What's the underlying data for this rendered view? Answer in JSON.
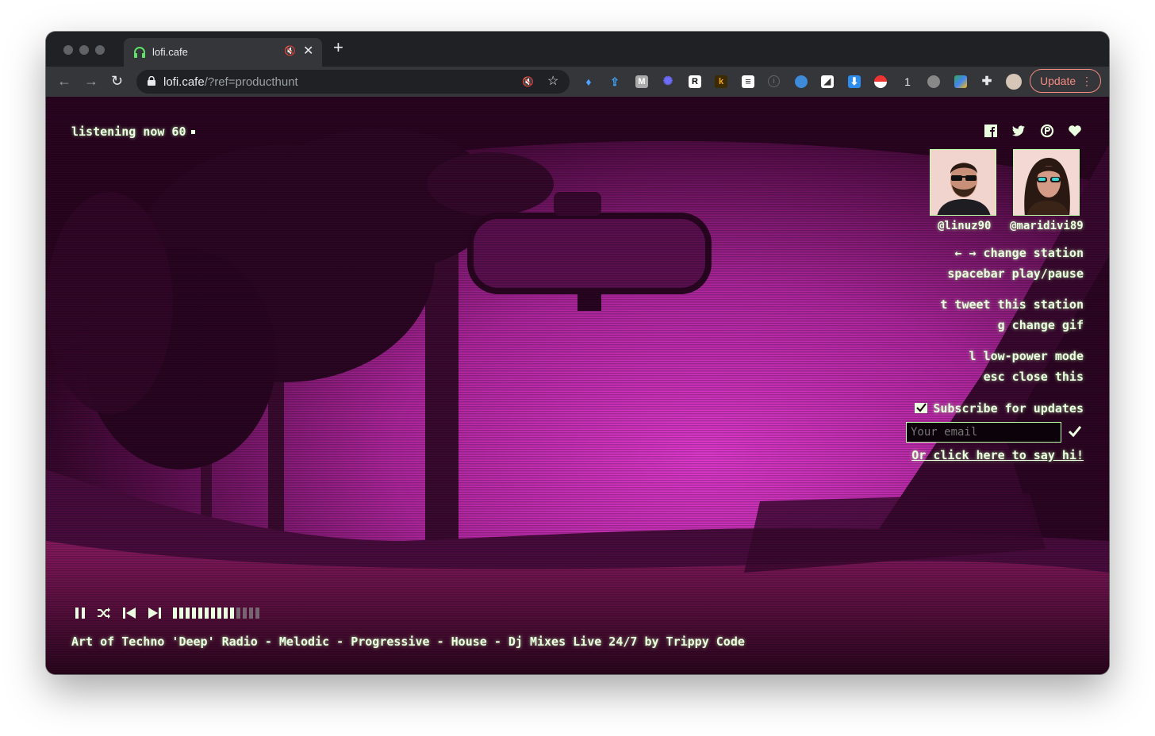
{
  "browser": {
    "tab_title": "lofi.cafe",
    "url_host": "lofi.cafe",
    "url_path": "/?ref=producthunt",
    "update_label": "Update",
    "extension_badge_count": "1",
    "ext_letters": [
      "M",
      "R",
      "k"
    ]
  },
  "page": {
    "listening_label": "listening now 60",
    "users": [
      {
        "handle": "@linuz90"
      },
      {
        "handle": "@maridivi89"
      }
    ],
    "help": {
      "change_station": "← → change station",
      "play_pause": "spacebar play/pause",
      "tweet": "t tweet this station",
      "gif": "g change gif",
      "low_power": "l low-power mode",
      "close": "esc close this"
    },
    "subscribe_label": "Subscribe for updates",
    "email_placeholder": "Your email",
    "say_hi_label": "Or click here to say hi!",
    "volume_level": 0.7,
    "station_title": "Art of Techno 'Deep' Radio - Melodic - Progressive - House - Dj Mixes Live 24/7 by Trippy Code"
  },
  "colors": {
    "hud_text": "#eaffdf",
    "accent_border": "#bfffa8",
    "update": "#f28b82"
  },
  "icons": [
    "facebook-icon",
    "twitter-icon",
    "product-hunt-icon",
    "heart-icon",
    "pause-icon",
    "shuffle-icon",
    "previous-icon",
    "next-icon",
    "checkmark-icon",
    "mail-check-icon"
  ]
}
